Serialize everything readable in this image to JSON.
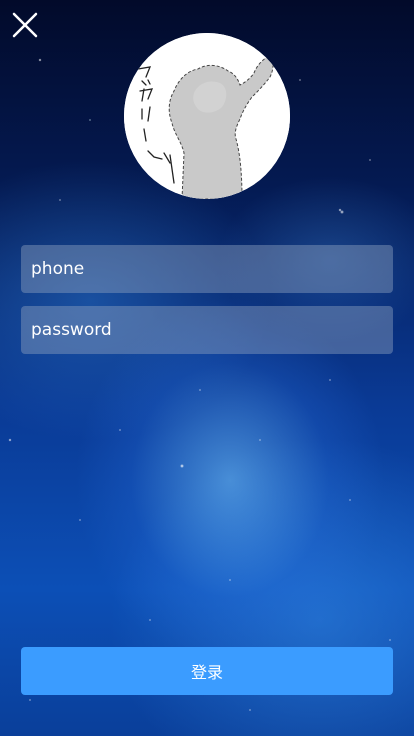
{
  "header": {
    "close_icon": "close-icon"
  },
  "avatar": {
    "icon": "avatar-image",
    "handwritten_text": "アッカリ〜ン"
  },
  "form": {
    "phone_placeholder": "phone",
    "phone_value": "",
    "password_placeholder": "password",
    "password_value": ""
  },
  "actions": {
    "login_label": "登录"
  },
  "colors": {
    "accent": "#3b9cff",
    "input_bg": "rgba(140,160,190,0.45)",
    "text": "#ffffff"
  }
}
